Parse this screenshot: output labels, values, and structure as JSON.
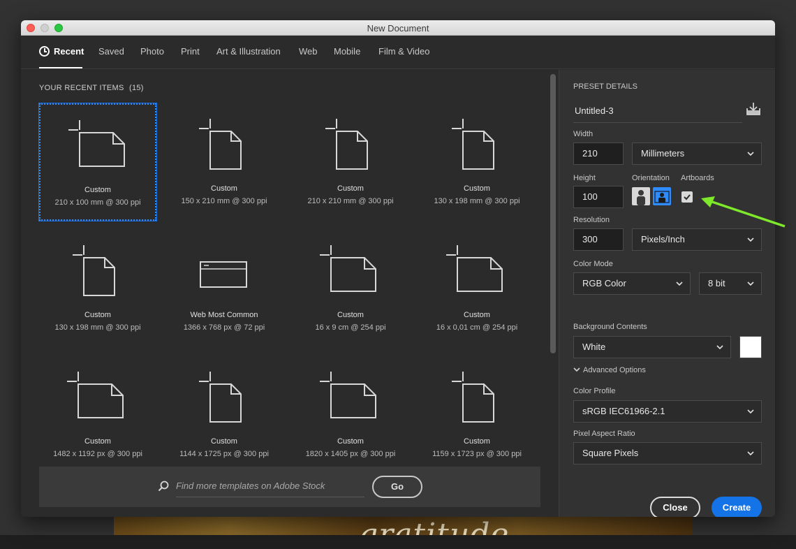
{
  "window": {
    "title": "New Document"
  },
  "tabs": [
    "Recent",
    "Saved",
    "Photo",
    "Print",
    "Art & Illustration",
    "Web",
    "Mobile",
    "Film & Video"
  ],
  "recent": {
    "heading": "YOUR RECENT ITEMS",
    "count": "(15)",
    "items": [
      {
        "name": "Custom",
        "size": "210 x 100 mm @ 300 ppi",
        "icon": "landscape-doc-icon",
        "selected": true
      },
      {
        "name": "Custom",
        "size": "150 x 210 mm @ 300 ppi",
        "icon": "portrait-doc-icon"
      },
      {
        "name": "Custom",
        "size": "210 x 210 mm @ 300 ppi",
        "icon": "portrait-doc-icon"
      },
      {
        "name": "Custom",
        "size": "130 x 198 mm @ 300 ppi",
        "icon": "portrait-doc-icon"
      },
      {
        "name": "Custom",
        "size": "130 x 198 mm @ 300 ppi",
        "icon": "portrait-doc-icon"
      },
      {
        "name": "Web Most Common",
        "size": "1366 x 768 px @ 72 ppi",
        "icon": "browser-window-icon"
      },
      {
        "name": "Custom",
        "size": "16 x 9 cm @ 254 ppi",
        "icon": "landscape-doc-icon"
      },
      {
        "name": "Custom",
        "size": "16 x 0,01 cm @ 254 ppi",
        "icon": "landscape-doc-icon"
      },
      {
        "name": "Custom",
        "size": "1482 x 1192 px @ 300 ppi",
        "icon": "landscape-doc-icon"
      },
      {
        "name": "Custom",
        "size": "1144 x 1725 px @ 300 ppi",
        "icon": "portrait-doc-icon"
      },
      {
        "name": "Custom",
        "size": "1820 x 1405 px @ 300 ppi",
        "icon": "landscape-doc-icon"
      },
      {
        "name": "Custom",
        "size": "1159 x 1723 px @ 300 ppi",
        "icon": "portrait-doc-icon"
      }
    ]
  },
  "stock": {
    "placeholder": "Find more templates on Adobe Stock",
    "go_label": "Go"
  },
  "preset": {
    "heading": "PRESET DETAILS",
    "name": "Untitled-3",
    "width_label": "Width",
    "width": "210",
    "width_unit": "Millimeters",
    "height_label": "Height",
    "height": "100",
    "orientation_label": "Orientation",
    "artboards_label": "Artboards",
    "artboards_checked": true,
    "resolution_label": "Resolution",
    "resolution": "300",
    "resolution_unit": "Pixels/Inch",
    "color_mode_label": "Color Mode",
    "color_mode": "RGB Color",
    "bit_depth": "8 bit",
    "background_label": "Background Contents",
    "background": "White",
    "background_color": "#ffffff",
    "advanced_label": "Advanced Options",
    "color_profile_label": "Color Profile",
    "color_profile": "sRGB IEC61966-2.1",
    "pixel_aspect_label": "Pixel Aspect Ratio",
    "pixel_aspect": "Square Pixels"
  },
  "actions": {
    "close_label": "Close",
    "create_label": "Create"
  },
  "colors": {
    "accent": "#1473e6",
    "annotation_arrow": "#7ee82a"
  }
}
